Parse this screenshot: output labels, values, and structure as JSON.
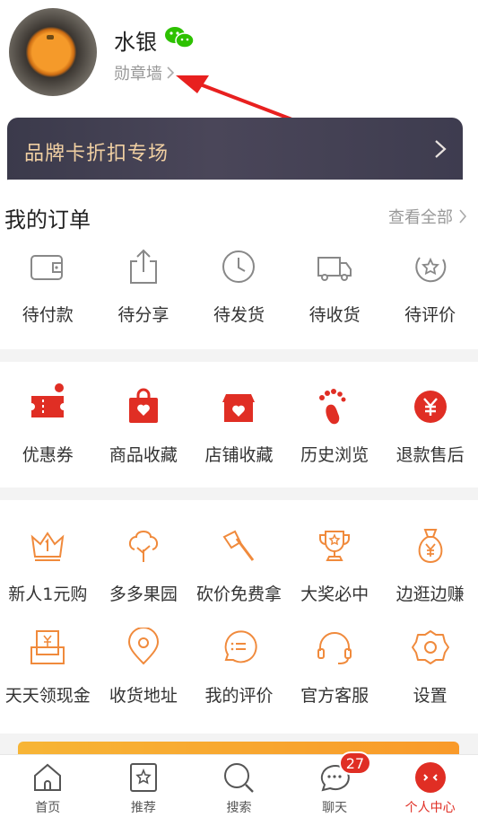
{
  "profile": {
    "username": "水银",
    "badge_wall": "勋章墙"
  },
  "brand_card": {
    "label": "品牌卡折扣专场"
  },
  "orders": {
    "title": "我的订单",
    "view_all": "查看全部",
    "items": [
      {
        "label": "待付款",
        "icon": "wallet-icon"
      },
      {
        "label": "待分享",
        "icon": "share-icon"
      },
      {
        "label": "待发货",
        "icon": "clock-icon"
      },
      {
        "label": "待收货",
        "icon": "truck-icon"
      },
      {
        "label": "待评价",
        "icon": "review-star-icon"
      }
    ]
  },
  "shortcuts": {
    "items": [
      {
        "label": "优惠券",
        "icon": "coupon-icon"
      },
      {
        "label": "商品收藏",
        "icon": "bag-heart-icon"
      },
      {
        "label": "店铺收藏",
        "icon": "shop-heart-icon"
      },
      {
        "label": "历史浏览",
        "icon": "footprint-icon"
      },
      {
        "label": "退款售后",
        "icon": "refund-yen-icon"
      }
    ]
  },
  "services": {
    "row1": [
      {
        "label": "新人1元购",
        "icon": "crown-icon"
      },
      {
        "label": "多多果园",
        "icon": "tree-icon"
      },
      {
        "label": "砍价免费拿",
        "icon": "axe-icon"
      },
      {
        "label": "大奖必中",
        "icon": "trophy-icon"
      },
      {
        "label": "边逛边赚",
        "icon": "money-bag-icon"
      }
    ],
    "row2": [
      {
        "label": "天天领现金",
        "icon": "cash-envelope-icon"
      },
      {
        "label": "收货地址",
        "icon": "location-pin-icon"
      },
      {
        "label": "我的评价",
        "icon": "comment-icon"
      },
      {
        "label": "官方客服",
        "icon": "headset-icon"
      },
      {
        "label": "设置",
        "icon": "gear-icon"
      }
    ]
  },
  "tabbar": {
    "items": [
      {
        "label": "首页",
        "icon": "home-icon"
      },
      {
        "label": "推荐",
        "icon": "recommend-icon"
      },
      {
        "label": "搜索",
        "icon": "search-icon"
      },
      {
        "label": "聊天",
        "icon": "chat-icon",
        "badge": "27"
      },
      {
        "label": "个人中心",
        "icon": "profile-icon"
      }
    ],
    "active_index": 4
  },
  "colors": {
    "accent": "#e02e24",
    "service_orange": "#f08a3c",
    "brand_gold": "#f0cfa2"
  }
}
